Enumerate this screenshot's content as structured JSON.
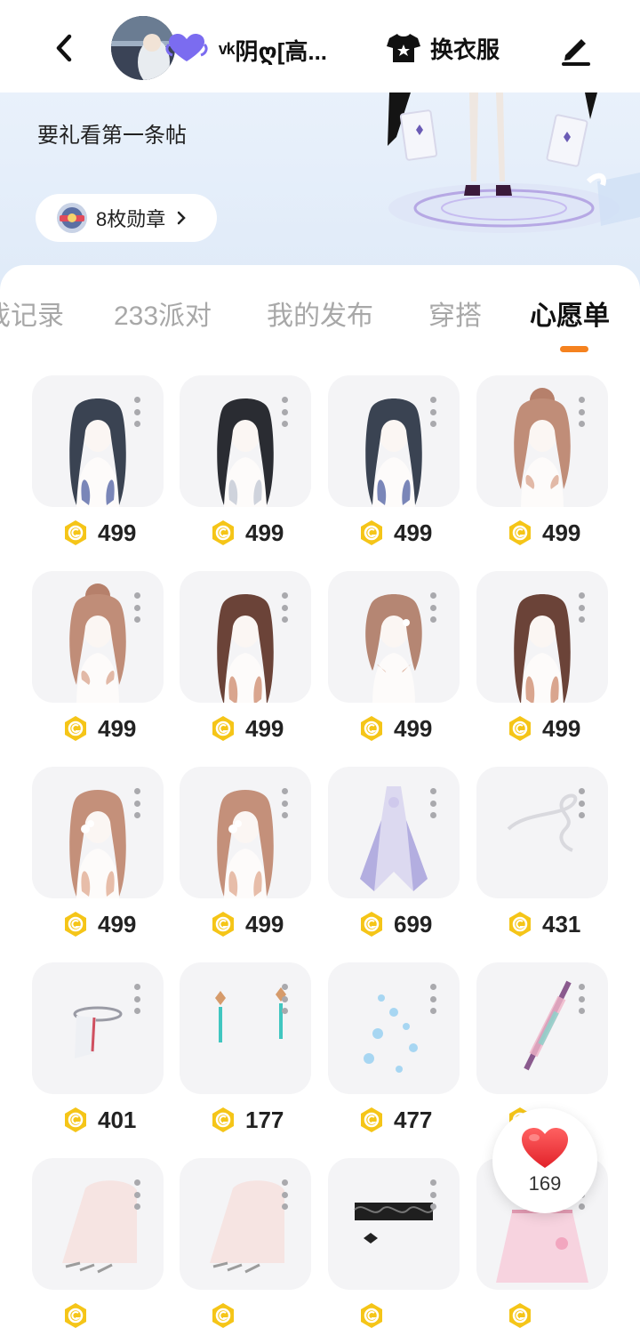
{
  "header": {
    "username": "ᵛᵏ阴ღ[高...",
    "outfit_label": "换衣服",
    "icons": {
      "back": "chevron-left-icon",
      "heart": "heart-badge-icon",
      "shirt": "shirt-icon",
      "edit": "edit-pencil-icon"
    }
  },
  "profile": {
    "bio": "要礼看第一条帖",
    "medal_label": "8枚勋章"
  },
  "tabs": [
    {
      "label": "戏记录",
      "active": false
    },
    {
      "label": "233派对",
      "active": false
    },
    {
      "label": "我的发布",
      "active": false
    },
    {
      "label": "穿搭",
      "active": false
    },
    {
      "label": "心愿单",
      "active": true
    }
  ],
  "colors": {
    "accent": "#f5821f",
    "coin": "#f5c518",
    "like": "#f03a3a"
  },
  "items": [
    {
      "kind": "hair-dark-long",
      "price": "499"
    },
    {
      "kind": "hair-black-wavy",
      "price": "499"
    },
    {
      "kind": "hair-dark-long",
      "price": "499"
    },
    {
      "kind": "hair-bun-brown",
      "price": "499"
    },
    {
      "kind": "hair-bun-brown",
      "price": "499"
    },
    {
      "kind": "hair-brown-long",
      "price": "499"
    },
    {
      "kind": "hair-brown-short",
      "price": "499"
    },
    {
      "kind": "hair-brown-long",
      "price": "499"
    },
    {
      "kind": "hair-side-ponytail",
      "price": "499"
    },
    {
      "kind": "hair-side-ponytail",
      "price": "499"
    },
    {
      "kind": "dress-lavender",
      "price": "699"
    },
    {
      "kind": "ribbon-silver",
      "price": "431"
    },
    {
      "kind": "veil-headpiece",
      "price": "401"
    },
    {
      "kind": "tassel-earrings",
      "price": "177"
    },
    {
      "kind": "sparkle-effect",
      "price": "477"
    },
    {
      "kind": "hair-pin",
      "price": ""
    },
    {
      "kind": "hand-rings",
      "price": ""
    },
    {
      "kind": "hand-rings",
      "price": ""
    },
    {
      "kind": "lace-choker",
      "price": ""
    },
    {
      "kind": "pink-skirt",
      "price": ""
    }
  ],
  "like": {
    "count": "169"
  }
}
